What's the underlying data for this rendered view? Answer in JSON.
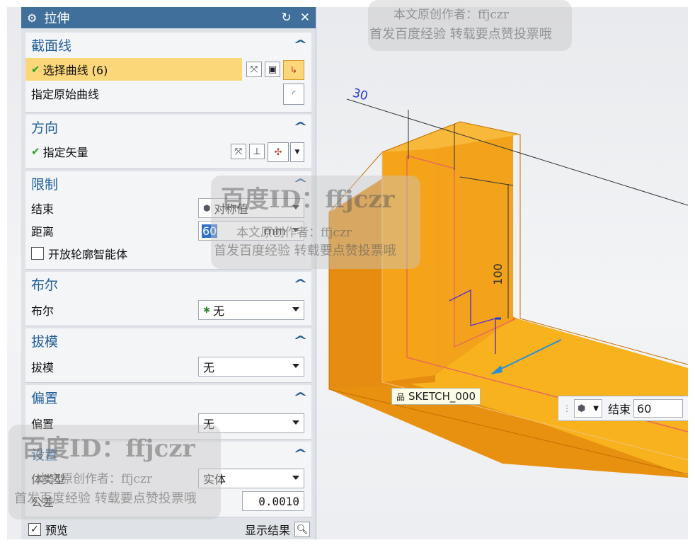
{
  "dialog": {
    "title": "拉伸",
    "gear_icon": "gear-icon",
    "reset_icon": "reset-icon",
    "close_icon": "close-icon"
  },
  "sections": {
    "section_curve": {
      "title": "截面线",
      "select_curve_label": "选择曲线 (6)",
      "origin_curve_label": "指定原始曲线"
    },
    "direction": {
      "title": "方向",
      "vector_label": "指定矢量"
    },
    "limits": {
      "title": "限制",
      "end_label": "结束",
      "end_value": "对称值",
      "distance_label": "距离",
      "distance_value": "60",
      "distance_unit": "mm",
      "open_profile_label": "开放轮廓智能体"
    },
    "boolean": {
      "title": "布尔",
      "label": "布尔",
      "value": "无"
    },
    "draft": {
      "title": "拔模",
      "label": "拔模",
      "value": "无"
    },
    "offset": {
      "title": "偏置",
      "label": "偏置",
      "value": "无"
    },
    "settings": {
      "title": "设置",
      "body_type_label": "体类型",
      "body_type_value": "实体",
      "tolerance_label": "公差",
      "tolerance_value": "0.0010"
    }
  },
  "footer": {
    "preview_label": "预览",
    "preview_checked": true,
    "show_result_label": "显示结果"
  },
  "viewport": {
    "dim_top": "30",
    "dim_height": "100",
    "sketch_label": "SKETCH_000",
    "onscreen_end_label": "结束",
    "onscreen_end_value": "60",
    "model_color": "#f5a623"
  },
  "watermarks": {
    "id_text": "百度ID：ffjczr",
    "line1": "本文原创作者：ffjczr",
    "line2": "首发百度经验 转载要点赞投票哦"
  }
}
